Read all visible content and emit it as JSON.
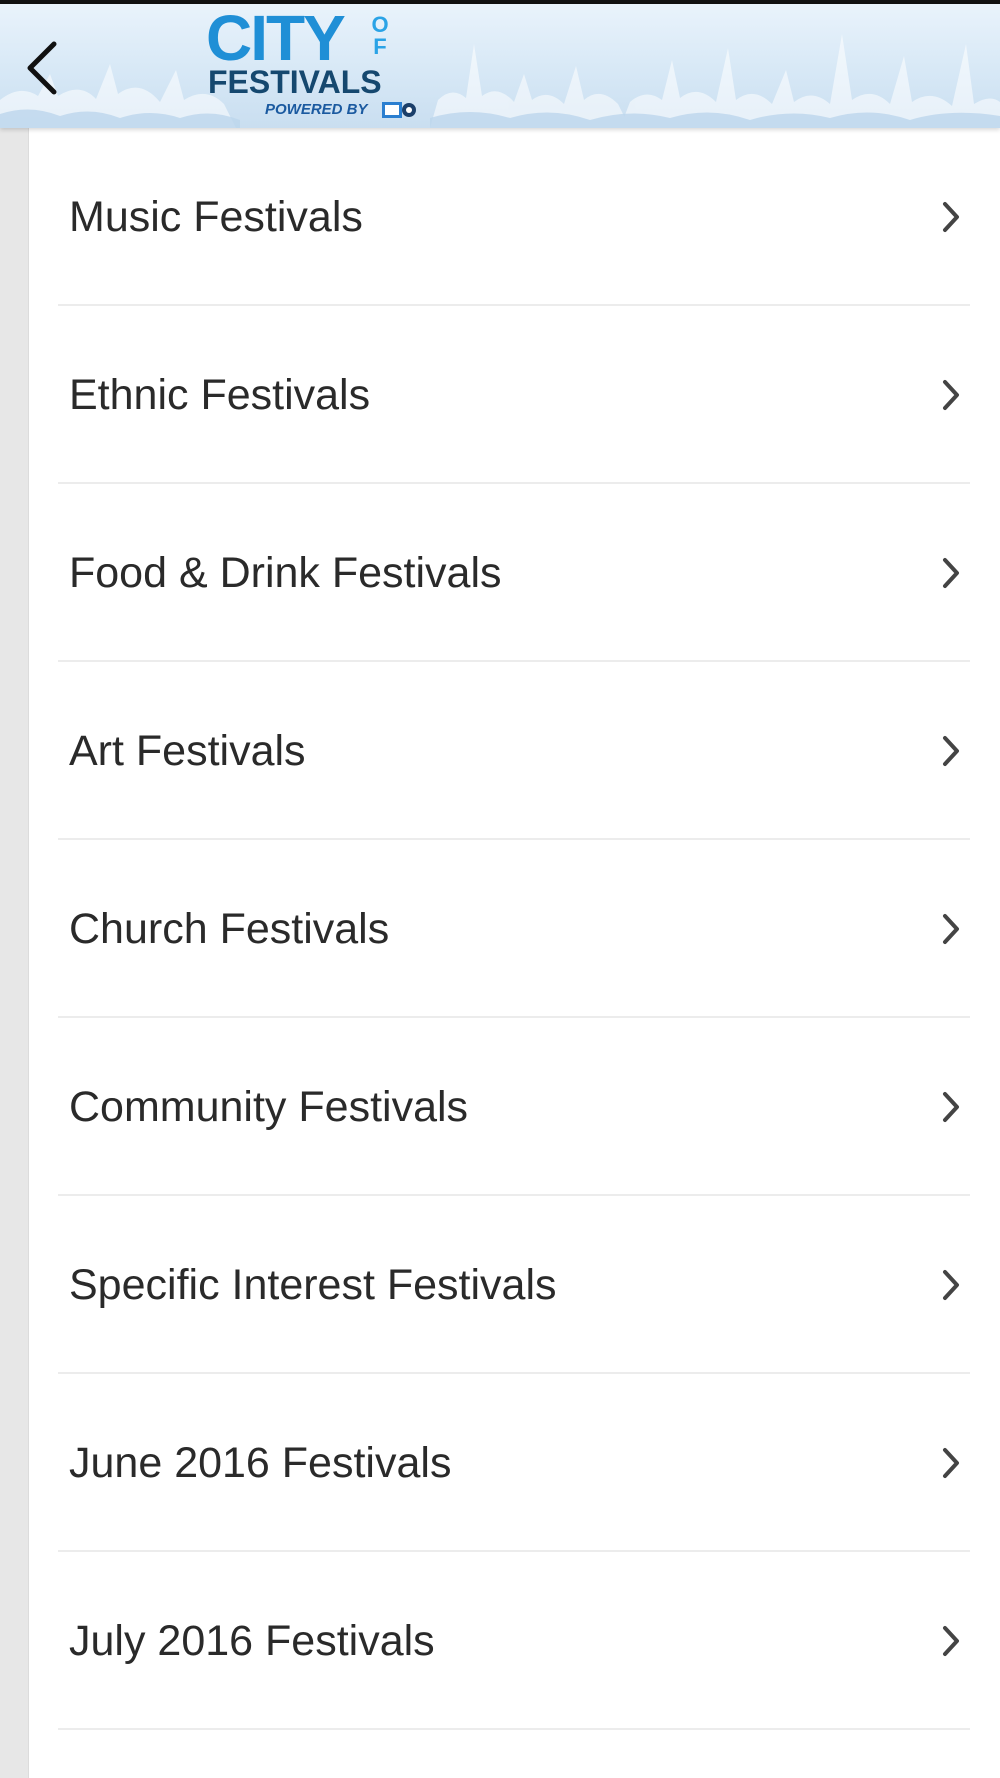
{
  "header": {
    "logo": {
      "word_city": "CITY",
      "word_of": "OF",
      "word_festivals": "FESTIVALS",
      "powered_by": "POWERED BY"
    },
    "back_icon": "chevron-left-icon"
  },
  "colors": {
    "header_bg": "#d7e8f6",
    "logo_blue": "#1f8fd6",
    "logo_navy": "#15486f",
    "text": "#2a2a2a",
    "divider": "#ececec",
    "chevron": "#444444"
  },
  "menu": {
    "items": [
      {
        "label": "Music Festivals",
        "icon": "chevron-right-icon"
      },
      {
        "label": "Ethnic Festivals",
        "icon": "chevron-right-icon"
      },
      {
        "label": "Food & Drink Festivals",
        "icon": "chevron-right-icon"
      },
      {
        "label": "Art Festivals",
        "icon": "chevron-right-icon"
      },
      {
        "label": "Church Festivals",
        "icon": "chevron-right-icon"
      },
      {
        "label": "Community Festivals",
        "icon": "chevron-right-icon"
      },
      {
        "label": "Specific Interest Festivals",
        "icon": "chevron-right-icon"
      },
      {
        "label": "June 2016 Festivals",
        "icon": "chevron-right-icon"
      },
      {
        "label": "July 2016 Festivals",
        "icon": "chevron-right-icon"
      }
    ]
  }
}
